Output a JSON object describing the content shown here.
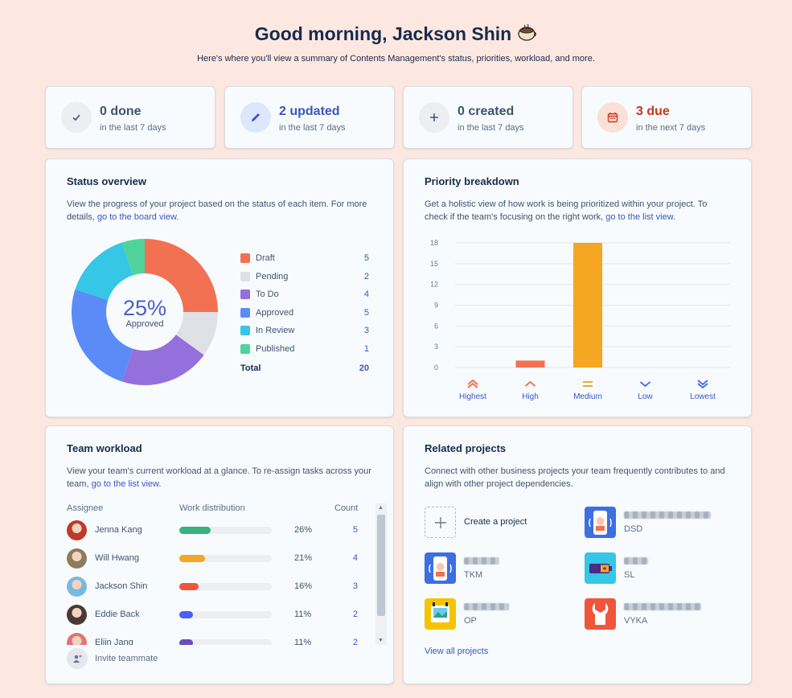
{
  "header": {
    "title": "Good morning, Jackson Shin",
    "subtitle": "Here's where you'll view a summary of Contents Management's status, priorities, workload, and more."
  },
  "stats": [
    {
      "value": "0 done",
      "period": "in the last 7 days",
      "icon": "check-icon",
      "color": "#42526e"
    },
    {
      "value": "2 updated",
      "period": "in the last 7 days",
      "icon": "pencil-icon",
      "color": "#3b55c4"
    },
    {
      "value": "0 created",
      "period": "in the last 7 days",
      "icon": "plus-icon",
      "color": "#42526e"
    },
    {
      "value": "3 due",
      "period": "in the next 7 days",
      "icon": "calendar-icon",
      "color": "#c4381d"
    }
  ],
  "status_overview": {
    "title": "Status overview",
    "desc": "View the progress of your project based on the status of each item. For more details, ",
    "link": "go to the board view",
    "center_value": "25%",
    "center_label": "Approved",
    "total_label": "Total",
    "total_value": "20",
    "items": [
      {
        "label": "Draft",
        "value": 5,
        "color": "#f27152"
      },
      {
        "label": "Pending",
        "value": 2,
        "color": "#dfe1e6"
      },
      {
        "label": "To Do",
        "value": 4,
        "color": "#9370db"
      },
      {
        "label": "Approved",
        "value": 5,
        "color": "#5b8bf7"
      },
      {
        "label": "In Review",
        "value": 3,
        "color": "#36c6e6"
      },
      {
        "label": "Published",
        "value": 1,
        "color": "#4fd39a"
      }
    ]
  },
  "priority": {
    "title": "Priority breakdown",
    "desc": "Get a holistic view of how work is being prioritized within your project. To check if the team's focusing on the right work, ",
    "link": "go to the list view"
  },
  "chart_data": {
    "type": "bar",
    "categories": [
      "Highest",
      "High",
      "Medium",
      "Low",
      "Lowest"
    ],
    "values": [
      0,
      1,
      18,
      0,
      0
    ],
    "colors": [
      "#f27152",
      "#f27152",
      "#f5a623",
      "#4c6ef5",
      "#4c6ef5"
    ],
    "yticks": [
      "18",
      "15",
      "12",
      "9",
      "6",
      "3",
      "0"
    ],
    "ylim": [
      0,
      18
    ]
  },
  "workload": {
    "title": "Team workload",
    "desc": "View your team's current workload at a glance. To re-assign tasks across your team, ",
    "link": "go to the list view",
    "col_assignee": "Assignee",
    "col_dist": "Work distribution",
    "col_count": "Count",
    "rows": [
      {
        "name": "Jenna Kang",
        "pct": "26%",
        "frac": 0.26,
        "count": "5",
        "color": "#36b37e",
        "avatar": "#c0392b"
      },
      {
        "name": "Will Hwang",
        "pct": "21%",
        "frac": 0.21,
        "count": "4",
        "color": "#f5a623",
        "avatar": "#8d7b5c"
      },
      {
        "name": "Jackson Shin",
        "pct": "16%",
        "frac": 0.16,
        "count": "3",
        "color": "#f0553c",
        "avatar": "#7ab8e0"
      },
      {
        "name": "Eddie Back",
        "pct": "11%",
        "frac": 0.11,
        "count": "2",
        "color": "#4c5ef5",
        "avatar": "#4a3a32"
      },
      {
        "name": "Eljin Jang",
        "pct": "11%",
        "frac": 0.11,
        "count": "2",
        "color": "#6b4fbb",
        "avatar": "#e57373"
      }
    ],
    "invite": "Invite teammate"
  },
  "related": {
    "title": "Related projects",
    "desc": "Connect with other business projects your team frequently contributes to and align with other project dependencies.",
    "create": "Create a project",
    "view_all": "View all projects",
    "projects": [
      {
        "key": "DSD",
        "icon": "phone-app-icon"
      },
      {
        "key": "TKM",
        "icon": "phone-app-icon"
      },
      {
        "key": "SL",
        "icon": "battery-icon"
      },
      {
        "key": "OP",
        "icon": "picture-icon"
      },
      {
        "key": "VYKA",
        "icon": "wrench-icon"
      }
    ]
  }
}
